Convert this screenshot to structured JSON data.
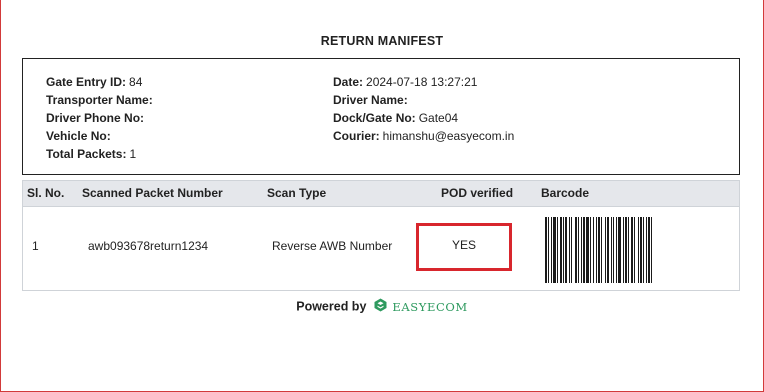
{
  "title": "RETURN MANIFEST",
  "info": {
    "left": [
      {
        "label": "Gate Entry ID:",
        "value": "84"
      },
      {
        "label": "Transporter Name:",
        "value": ""
      },
      {
        "label": "Driver Phone No:",
        "value": ""
      },
      {
        "label": "Vehicle No:",
        "value": ""
      },
      {
        "label": "Total Packets:",
        "value": "1"
      }
    ],
    "right": [
      {
        "label": "Date:",
        "value": "2024-07-18 13:27:21"
      },
      {
        "label": "Driver Name:",
        "value": ""
      },
      {
        "label": "Dock/Gate No:",
        "value": "Gate04"
      },
      {
        "label": "Courier:",
        "value": "himanshu@easyecom.in"
      }
    ]
  },
  "table": {
    "headers": [
      "Sl. No.",
      "Scanned Packet Number",
      "Scan Type",
      "POD verified",
      "Barcode"
    ],
    "rows": [
      {
        "sl": "1",
        "packet": "awb093678return1234",
        "scan_type": "Reverse AWB Number",
        "pod": "YES",
        "barcode_icon": "barcode"
      }
    ]
  },
  "footer": {
    "powered_by": "Powered by",
    "brand": "EASYECOM",
    "logo_icon": "easyecom-logo"
  },
  "colors": {
    "frame": "#d23a3a",
    "highlight": "#d8262d",
    "brand": "#2e9a5f",
    "header_bg": "#e5e7eb"
  }
}
